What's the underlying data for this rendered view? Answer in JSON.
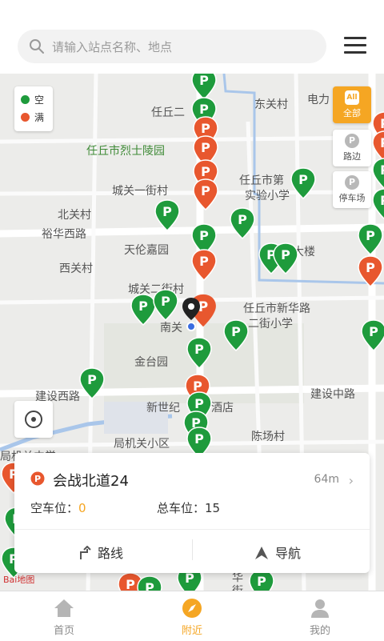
{
  "search": {
    "placeholder": "请输入站点名称、地点",
    "icon": "search-icon"
  },
  "menu_icon": "hamburger-menu-icon",
  "legend": {
    "items": [
      {
        "label": "空",
        "color": "#1e9b3c"
      },
      {
        "label": "满",
        "color": "#e8572e"
      }
    ]
  },
  "filters": [
    {
      "label": "全部",
      "icon_text": "All",
      "active": true
    },
    {
      "label": "路边",
      "icon_text": "P",
      "active": false
    },
    {
      "label": "停车场",
      "icon_text": "P",
      "active": false
    }
  ],
  "map_labels": [
    "任丘二",
    "东关村",
    "电力",
    "任丘市烈士陵园",
    "城关一街村",
    "任丘市第",
    "实验小学",
    "北关村",
    "裕华西路",
    "天伦嘉园",
    "大楼",
    "西关村",
    "城关二街村",
    "任丘市新华路",
    "二街小学",
    "南关",
    "金台园",
    "建设西路",
    "建设中路",
    "新世纪",
    "酒店",
    "局机关小区",
    "陈场村",
    "局机关中学",
    "华",
    "街"
  ],
  "map_logo": "Bai地图",
  "colors": {
    "accent": "#f5a623",
    "free": "#1e9b3c",
    "full": "#e8572e"
  },
  "card": {
    "title": "会战北道24",
    "distance": "64m",
    "free_label": "空车位：",
    "free_value": "0",
    "total_label": "总车位：",
    "total_value": "15",
    "route_label": "路线",
    "nav_label": "导航"
  },
  "bottom_nav": [
    {
      "label": "首页",
      "icon": "home-icon",
      "active": false
    },
    {
      "label": "附近",
      "icon": "compass-icon",
      "active": true
    },
    {
      "label": "我的",
      "icon": "user-icon",
      "active": false
    }
  ]
}
